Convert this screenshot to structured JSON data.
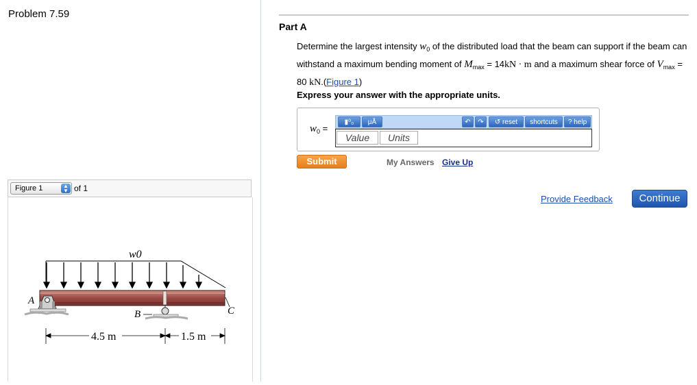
{
  "problem": {
    "title": "Problem 7.59"
  },
  "figure_nav": {
    "selected": "Figure 1",
    "of_text": "of 1"
  },
  "figure": {
    "labels": {
      "A": "A",
      "B": "B",
      "C": "C",
      "w0": "w0"
    },
    "dims": {
      "d1": "4.5 m",
      "d2": "1.5 m"
    }
  },
  "part": {
    "title": "Part A",
    "q1": "Determine the largest intensity",
    "q_w": "w",
    "q_w_sub": "0",
    "q2": " of the distributed load that the beam can support if the beam can withstand a maximum bending moment of ",
    "q_M": "M",
    "q_M_sub": "max",
    "q3": " = 14",
    "q_unit1": "kN · m",
    "q4": " and a maximum shear force of ",
    "q_V": "V",
    "q_V_sub": "max",
    "q5": " = 80 ",
    "q_unit2": "kN",
    "q6": ".(",
    "figure_link": "Figure 1",
    "q7": ")",
    "express": "Express your answer with the appropriate units."
  },
  "answer": {
    "var": "w",
    "var_sub": "0",
    "equals": " =",
    "value_placeholder": "Value",
    "units_placeholder": "Units",
    "toolbar": {
      "templates": "▮⁰₀",
      "units": "μÅ",
      "undo": "↶",
      "redo": "↷",
      "reset": "reset",
      "shortcuts": "shortcuts",
      "help": "help",
      "help_icon": "?"
    }
  },
  "actions": {
    "submit": "Submit",
    "my_answers": "My Answers",
    "give_up": "Give Up",
    "feedback": "Provide Feedback",
    "continue": "Continue"
  }
}
